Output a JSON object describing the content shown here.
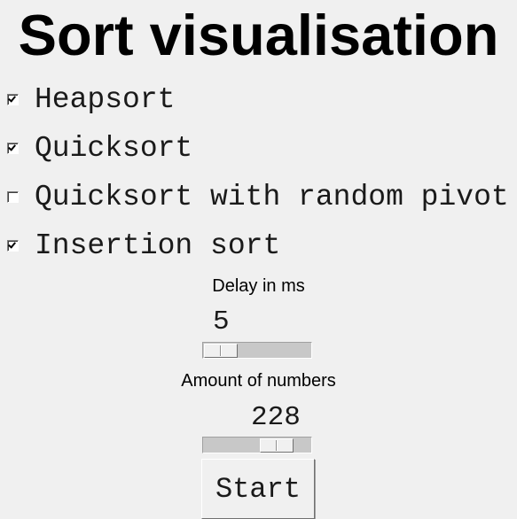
{
  "title": "Sort visualisation",
  "algorithms": [
    {
      "label": "Heapsort",
      "checked": true
    },
    {
      "label": "Quicksort",
      "checked": true
    },
    {
      "label": "Quicksort with random pivot",
      "checked": false
    },
    {
      "label": "Insertion sort",
      "checked": true
    }
  ],
  "delay": {
    "label": "Delay in ms",
    "value": "5"
  },
  "amount": {
    "label": "Amount of numbers",
    "value": "228"
  },
  "start_label": "Start"
}
